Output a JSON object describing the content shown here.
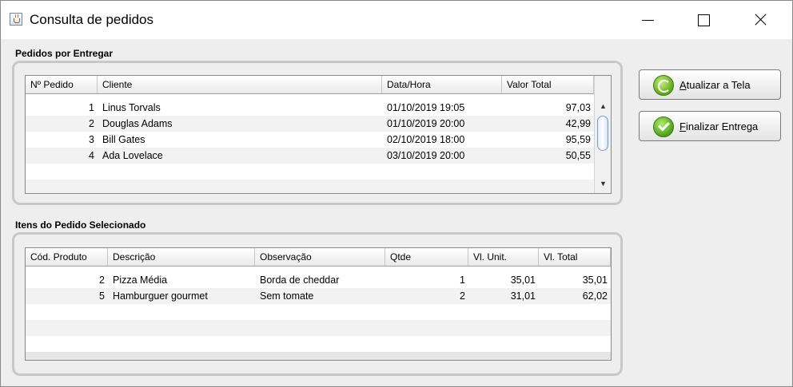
{
  "window": {
    "title": "Consulta de pedidos",
    "app_icon": "java-cup-icon",
    "controls": [
      "minimize-icon",
      "maximize-icon",
      "close-icon"
    ]
  },
  "orders_section": {
    "title": "Pedidos por Entregar",
    "columns": [
      "Nº Pedido",
      "Cliente",
      "Data/Hora",
      "Valor Total"
    ],
    "rows": [
      {
        "id": "1",
        "client": "Linus Torvals",
        "datetime": "01/10/2019 19:05",
        "total": "97,03"
      },
      {
        "id": "2",
        "client": "Douglas Adams",
        "datetime": "01/10/2019 20:00",
        "total": "42,99"
      },
      {
        "id": "3",
        "client": "Bill Gates",
        "datetime": "02/10/2019 18:00",
        "total": "95,59"
      },
      {
        "id": "4",
        "client": "Ada Lovelace",
        "datetime": "03/10/2019 20:00",
        "total": "50,55"
      }
    ]
  },
  "items_section": {
    "title": "Itens do Pedido Selecionado",
    "columns": [
      "Cód. Produto",
      "Descrição",
      "Observação",
      "Qtde",
      "Vl. Unit.",
      "Vl. Total"
    ],
    "rows": [
      {
        "code": "2",
        "description": "Pizza Média",
        "note": "Borda de cheddar",
        "qty": "1",
        "unit": "35,01",
        "total": "35,01"
      },
      {
        "code": "5",
        "description": "Hamburguer gourmet",
        "note": "Sem tomate",
        "qty": "2",
        "unit": "31,01",
        "total": "62,02"
      }
    ]
  },
  "buttons": {
    "refresh": {
      "mnemonic": "A",
      "rest": "tualizar a Tela",
      "icon": "refresh-icon"
    },
    "finish": {
      "mnemonic": "F",
      "rest": "inalizar Entrega",
      "icon": "checkmark-icon"
    }
  },
  "colors": {
    "window_bg": "#eeeeee",
    "row_alt": "#f2f2f2",
    "button_icon_green": "#5aa81b"
  }
}
